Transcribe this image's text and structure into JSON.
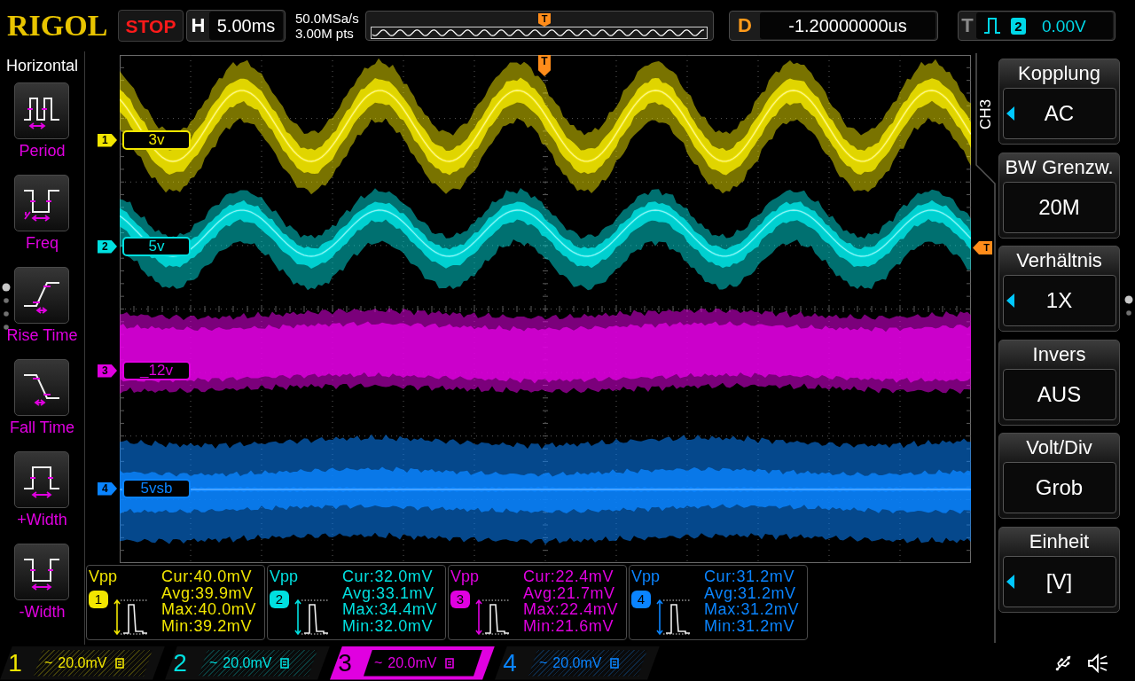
{
  "header": {
    "logo": "RIGOL",
    "run_state": "STOP",
    "timebase": {
      "label": "H",
      "value": "5.00ms"
    },
    "sample_rate": "50.0MSa/s",
    "memory_depth": "3.00M pts",
    "overview": {
      "trigger_marker": "T"
    },
    "delay": {
      "label": "D",
      "value": "-1.20000000us"
    },
    "trigger": {
      "label": "T",
      "source": "2",
      "level": "0.00V"
    }
  },
  "left_menu": {
    "title": "Horizontal",
    "items": [
      {
        "kind": "period",
        "label": "Period"
      },
      {
        "kind": "freq",
        "label": "Freq"
      },
      {
        "kind": "rise",
        "label": "Rise Time"
      },
      {
        "kind": "fall",
        "label": "Fall Time"
      },
      {
        "kind": "pos_width",
        "label": "+Width"
      },
      {
        "kind": "neg_width",
        "label": "-Width"
      }
    ]
  },
  "plot": {
    "trigger_position_marker": "T",
    "trigger_level_marker": "T",
    "channels": [
      {
        "number": "1",
        "label": "3v",
        "color": "#f2e600",
        "kind": "sine"
      },
      {
        "number": "2",
        "label": "5v",
        "color": "#00e0e0",
        "kind": "sine"
      },
      {
        "number": "3",
        "label": "_12v",
        "color": "#e000e0",
        "kind": "noise_band"
      },
      {
        "number": "4",
        "label": "5vsb",
        "color": "#0a84ff",
        "kind": "noise_band_line"
      }
    ]
  },
  "measurements": [
    {
      "type": "Vpp",
      "channel": "1",
      "color": "#f2e600",
      "readings": [
        "Cur:40.0mV",
        "Avg:39.9mV",
        "Max:40.0mV",
        "Min:39.2mV"
      ]
    },
    {
      "type": "Vpp",
      "channel": "2",
      "color": "#00e0e0",
      "readings": [
        "Cur:32.0mV",
        "Avg:33.1mV",
        "Max:34.4mV",
        "Min:32.0mV"
      ]
    },
    {
      "type": "Vpp",
      "channel": "3",
      "color": "#e000e0",
      "readings": [
        "Cur:22.4mV",
        "Avg:21.7mV",
        "Max:22.4mV",
        "Min:21.6mV"
      ]
    },
    {
      "type": "Vpp",
      "channel": "4",
      "color": "#0a84ff",
      "readings": [
        "Cur:31.2mV",
        "Avg:31.2mV",
        "Max:31.2mV",
        "Min:31.2mV"
      ]
    }
  ],
  "right_menu": {
    "channel": "CH3",
    "items": [
      {
        "label": "Kopplung",
        "value": "AC",
        "arrow": true
      },
      {
        "label": "BW Grenzw.",
        "value": "20M",
        "arrow": false
      },
      {
        "label": "Verhältnis",
        "value": "1X",
        "arrow": true
      },
      {
        "label": "Invers",
        "value": "AUS",
        "arrow": false
      },
      {
        "label": "Volt/Div",
        "value": "Grob",
        "arrow": false
      },
      {
        "label": "Einheit",
        "value": "[V]",
        "arrow": true
      }
    ]
  },
  "channel_bar": [
    {
      "number": "1",
      "coupling": "~",
      "scale": "20.0mV",
      "color": "#f2e600",
      "selected": false
    },
    {
      "number": "2",
      "coupling": "~",
      "scale": "20.0mV",
      "color": "#00e0e0",
      "selected": false
    },
    {
      "number": "3",
      "coupling": "~",
      "scale": "20.0mV",
      "color": "#e000e0",
      "selected": true
    },
    {
      "number": "4",
      "coupling": "~",
      "scale": "20.0mV",
      "color": "#0a84ff",
      "selected": false
    }
  ]
}
